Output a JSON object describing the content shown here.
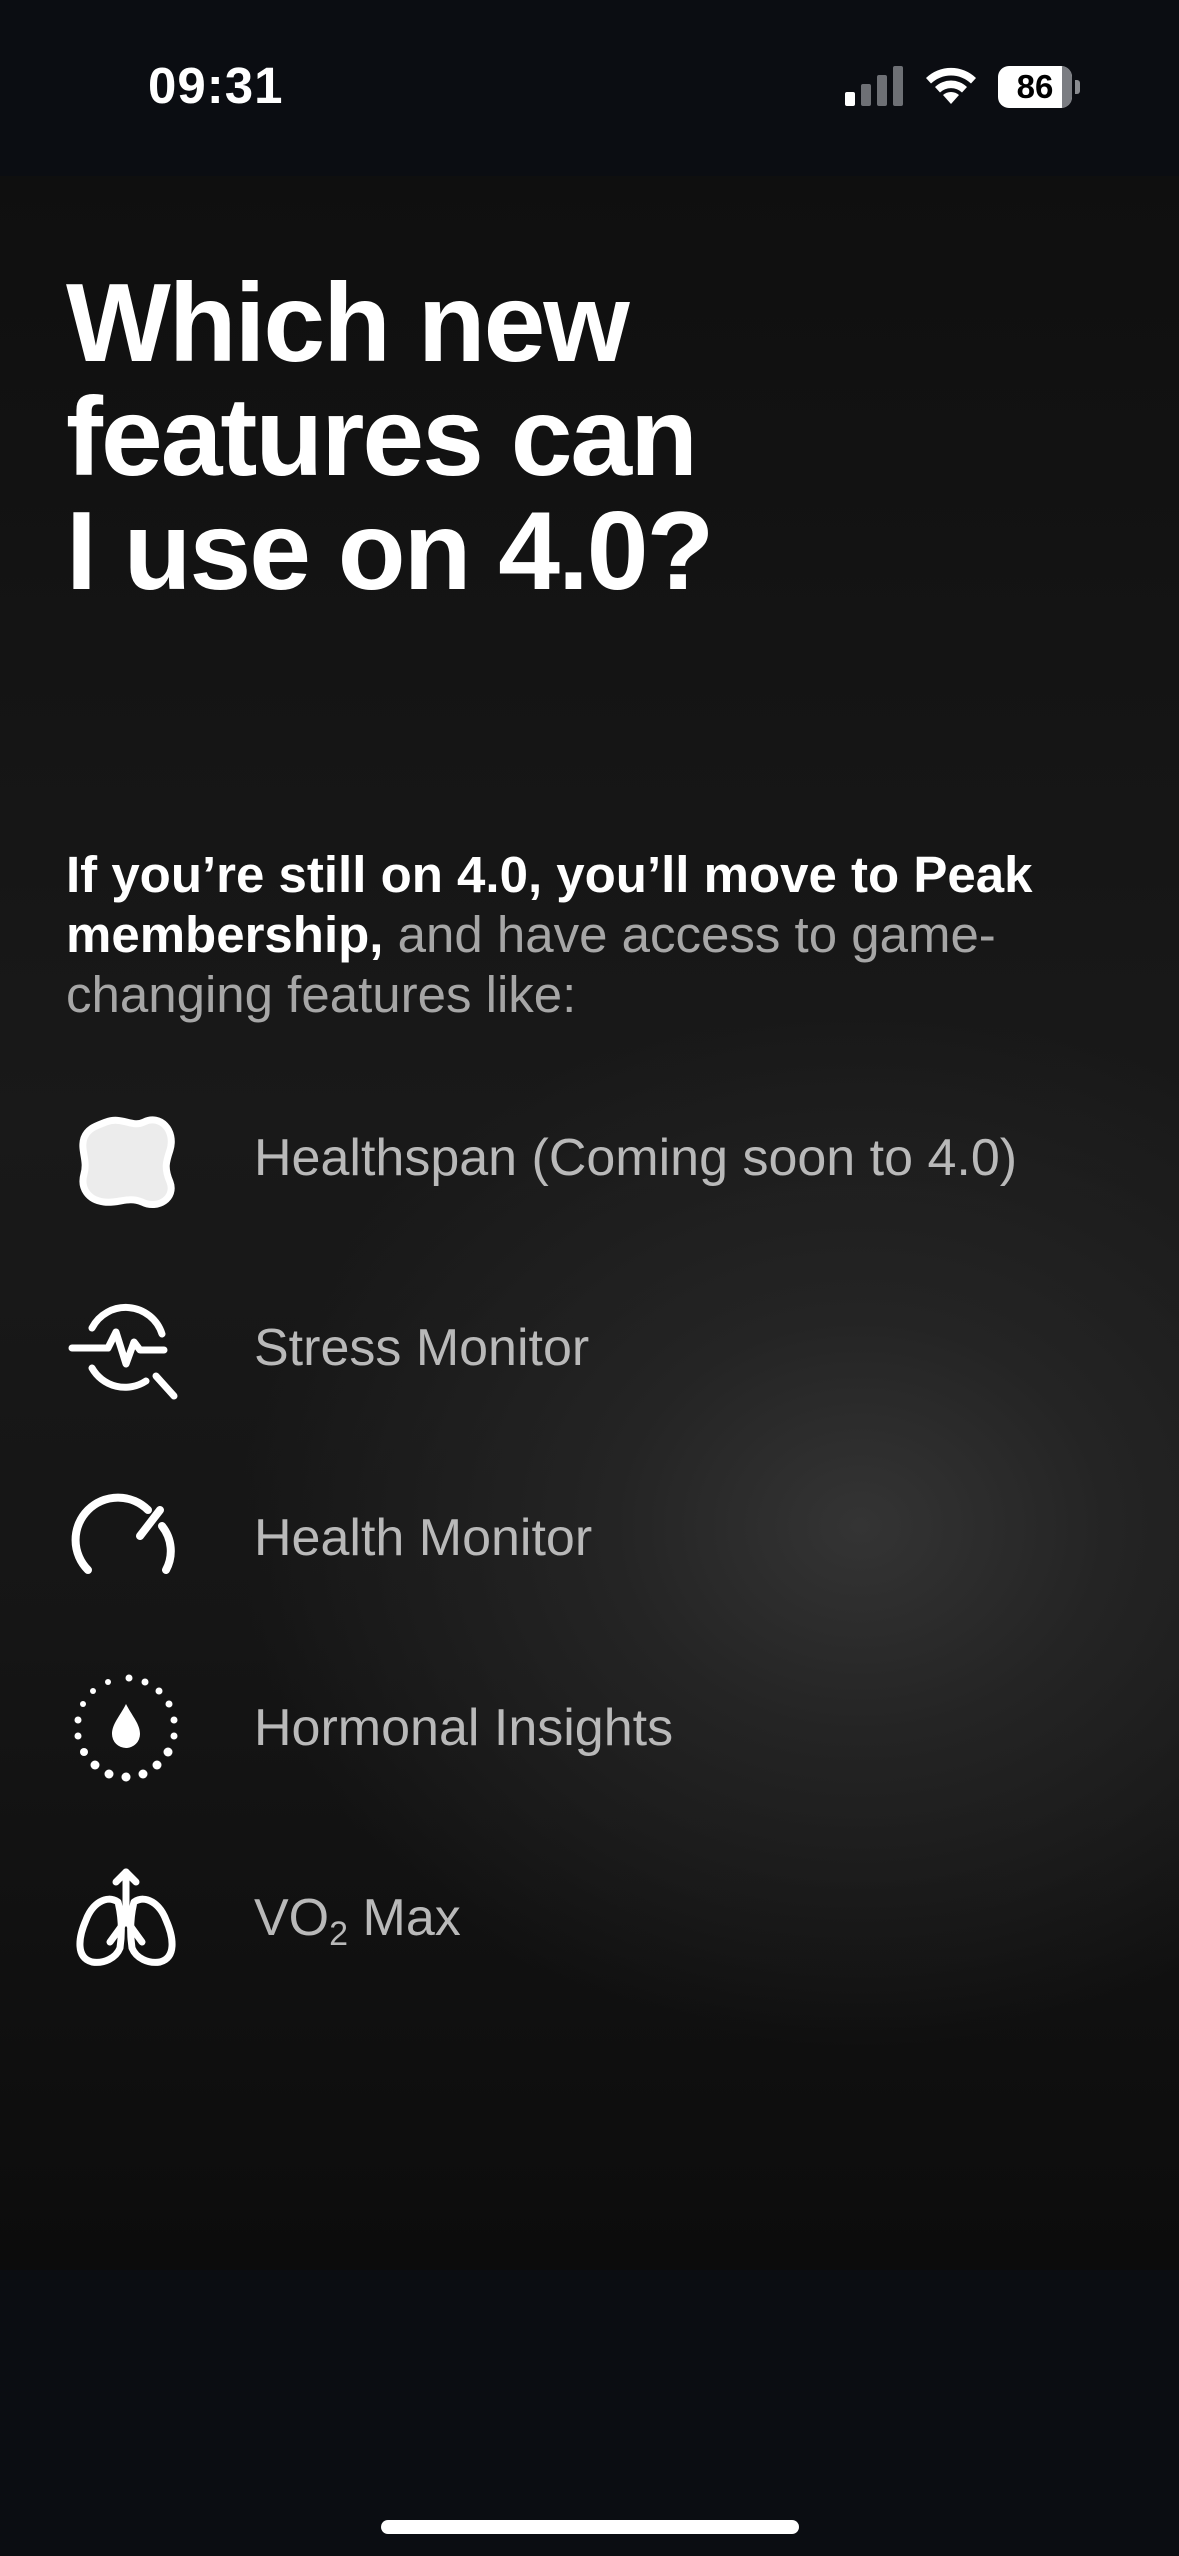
{
  "status_bar": {
    "time": "09:31",
    "battery_level": "86"
  },
  "title": "Which new\nfeatures can\nI use on 4.0?",
  "intro": {
    "lead": "If you’re still on 4.0, you’ll move to Peak membership,",
    "rest": " and have access to game-changing features like:"
  },
  "features": [
    {
      "label": "Healthspan (Coming soon to 4.0)",
      "icon": "healthspan-blob-icon"
    },
    {
      "label": "Stress Monitor",
      "icon": "stress-monitor-icon"
    },
    {
      "label": "Health Monitor",
      "icon": "gauge-icon"
    },
    {
      "label": "Hormonal Insights",
      "icon": "droplet-cycle-icon"
    },
    {
      "label_prefix": "VO",
      "label_sub": "2",
      "label_suffix": " Max",
      "icon": "lungs-icon"
    }
  ],
  "colors": {
    "background": "#0b0d12",
    "title": "#ffffff",
    "feature_text": "#b9b9b9",
    "muted_text": "#a6a6a6"
  }
}
